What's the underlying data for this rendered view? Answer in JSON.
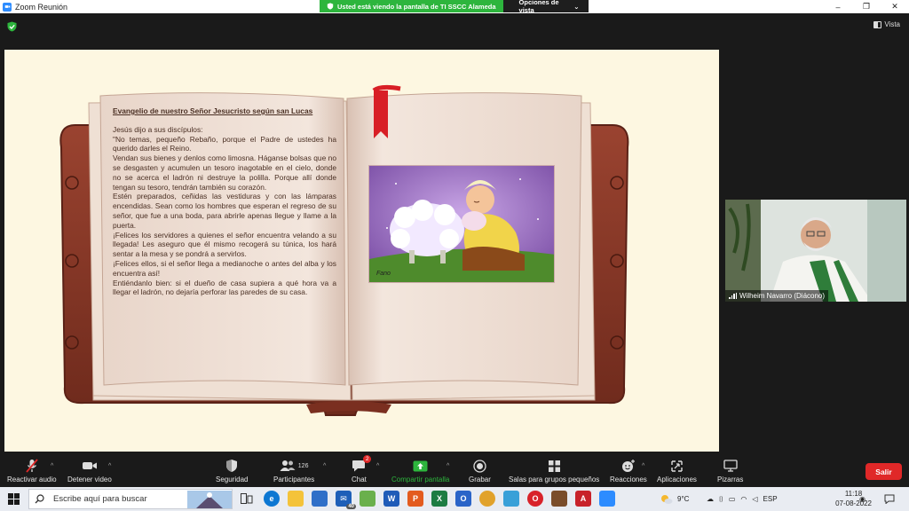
{
  "window": {
    "title": "Zoom Reunión",
    "controls": [
      "–",
      "❐",
      "✕"
    ]
  },
  "share_banner": {
    "message": "Usted está viendo la pantalla de TI SSCC Alameda",
    "view_options": "Opciones de vista"
  },
  "meeting": {
    "view_label": "Vista"
  },
  "shared_content": {
    "heading": "Evangelio de nuestro Señor Jesucristo según san Lucas",
    "paragraphs": [
      "Jesús dijo a sus discípulos:",
      "\"No temas, pequeño Rebaño, porque el Padre de ustedes ha querido darles el Reino.",
      "Vendan sus bienes y denlos como limosna. Háganse bolsas que no se desgasten y acumulen un tesoro inagotable en el cielo, donde no se acerca el ladrón ni destruye la polilla. Porque allí donde tengan su tesoro, tendrán también su corazón.",
      "Estén preparados, ceñidas las vestiduras y con las lámparas encendidas. Sean como los hombres que esperan el regreso de su señor, que fue a una boda, para abrirle apenas llegue y llame a la puerta.",
      "¡Felices los servidores a quienes el señor encuentra velando a su llegada! Les aseguro que él mismo recogerá su túnica, los hará sentar a la mesa y se pondrá a servirlos.",
      "¡Felices ellos, si el señor llega a medianoche o antes del alba y los encuentra así!",
      "Entiéndanlo bien: si el dueño de casa supiera a qué hora va a llegar el ladrón, no dejaría perforar las paredes de su casa."
    ],
    "illustration_signature": "Fano"
  },
  "participant": {
    "name": "Wilheim Navarro (Diácono)"
  },
  "toolbar": {
    "audio": "Reactivar audio",
    "video": "Detener video",
    "security": "Seguridad",
    "participants": "Participantes",
    "participants_count": "126",
    "chat": "Chat",
    "chat_badge": "2",
    "share": "Compartir pantalla",
    "record": "Grabar",
    "breakout": "Salas para grupos pequeños",
    "reactions": "Reacciones",
    "apps": "Aplicaciones",
    "whiteboard": "Pizarras",
    "leave": "Salir",
    "caret": "^"
  },
  "taskbar": {
    "search_placeholder": "Escribe aquí para buscar",
    "mail_badge": "40",
    "weather": "9°C",
    "language": "ESP",
    "time": "11:18",
    "date": "07-08-2022"
  },
  "colors": {
    "zoom_blue": "#2d8cff",
    "share_green": "#2db53d",
    "leave_red": "#e02828",
    "toolbar_bg": "#1a1a1a",
    "page_cream": "#fdf7e1",
    "book_leather": "#8a3b2a",
    "text_brown": "#4a2f23"
  }
}
